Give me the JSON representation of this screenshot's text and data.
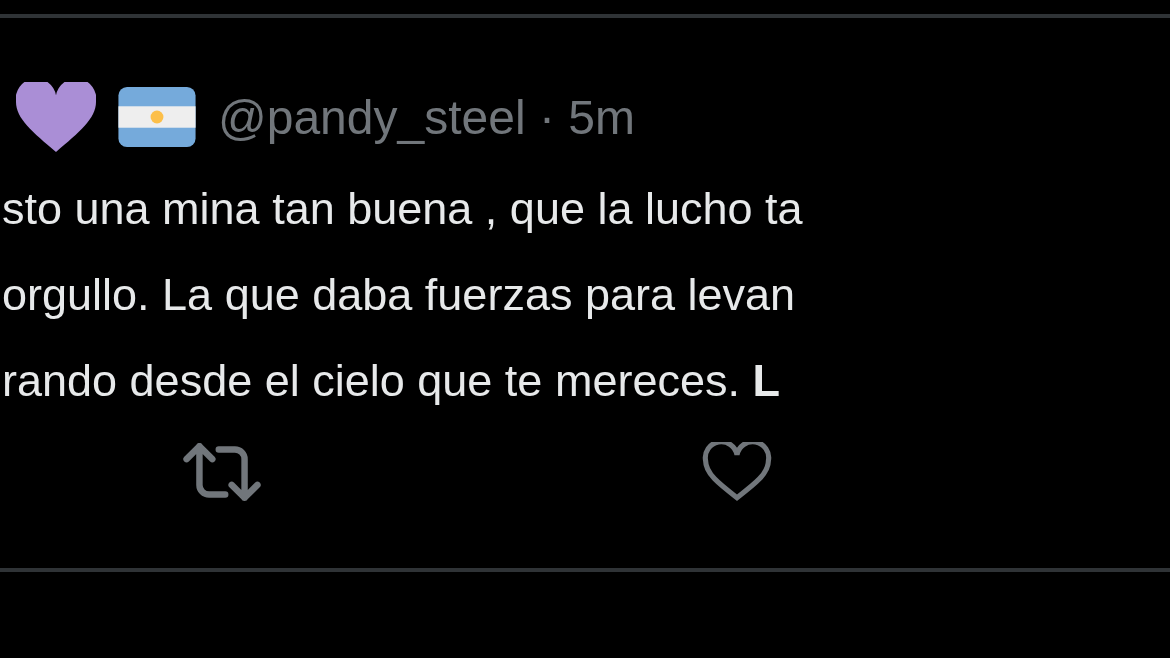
{
  "tweet": {
    "handle": "@pandy_steel",
    "separator": "·",
    "time": "5m",
    "lines": [
      "sto una mina tan buena , que la lucho ta",
      "orgullo. La que daba fuerzas para levan",
      "rando desde el cielo que te mereces. **L**"
    ]
  }
}
